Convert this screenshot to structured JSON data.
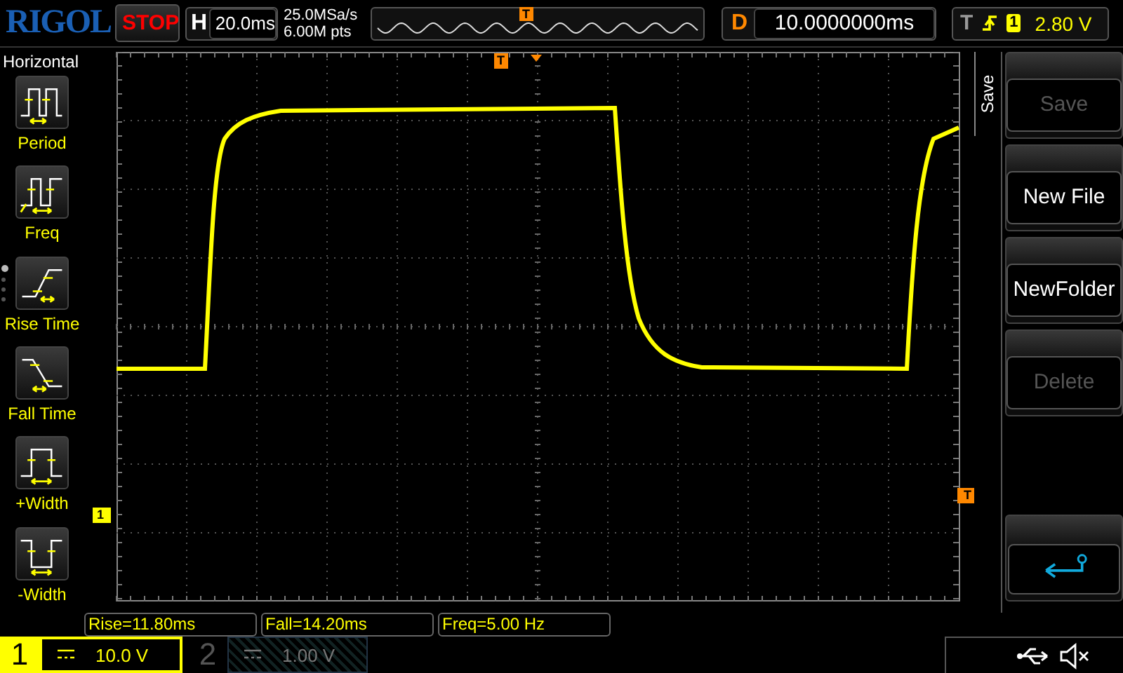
{
  "top_bar": {
    "logo": "RIGOL",
    "run_state": "STOP",
    "timebase": {
      "label": "H",
      "value": "20.0ms"
    },
    "sample_rate": "25.0MSa/s",
    "memory_depth": "6.00M pts",
    "overview": {
      "trigger_mark": "T"
    },
    "delay": {
      "label": "D",
      "value": "10.0000000ms"
    },
    "trigger": {
      "label": "T",
      "source": "1",
      "level": "2.80 V"
    }
  },
  "measure_menu": {
    "title": "Horizontal",
    "pages": [
      {
        "selected": true
      },
      {
        "selected": false
      },
      {
        "selected": false
      },
      {
        "selected": false
      }
    ],
    "items": [
      {
        "kind": "period",
        "label": "Period"
      },
      {
        "kind": "freq",
        "label": "Freq"
      },
      {
        "kind": "rise",
        "label": "Rise Time"
      },
      {
        "kind": "fall",
        "label": "Fall Time"
      },
      {
        "kind": "pwidth",
        "label": "+Width"
      },
      {
        "kind": "nwidth",
        "label": "-Width"
      }
    ]
  },
  "waveform": {
    "channel_marker": "1",
    "trigger_position_mark": "T",
    "trigger_level_mark": "T"
  },
  "softkey_menu": {
    "title": "Save",
    "keys": [
      {
        "kind": "text",
        "label": "Save",
        "disabled": true
      },
      {
        "kind": "text",
        "label": "New File",
        "disabled": false
      },
      {
        "kind": "text",
        "label": "NewFolder",
        "disabled": false
      },
      {
        "kind": "text",
        "label": "Delete",
        "disabled": true
      },
      {
        "kind": "empty"
      },
      {
        "kind": "back"
      }
    ]
  },
  "measurements": [
    "Rise=11.80ms",
    "Fall=14.20ms",
    "Freq=5.00 Hz"
  ],
  "channels": [
    {
      "number": "1",
      "scale": "10.0 V",
      "active": true
    },
    {
      "number": "2",
      "scale": "1.00 V",
      "active": false
    }
  ]
}
